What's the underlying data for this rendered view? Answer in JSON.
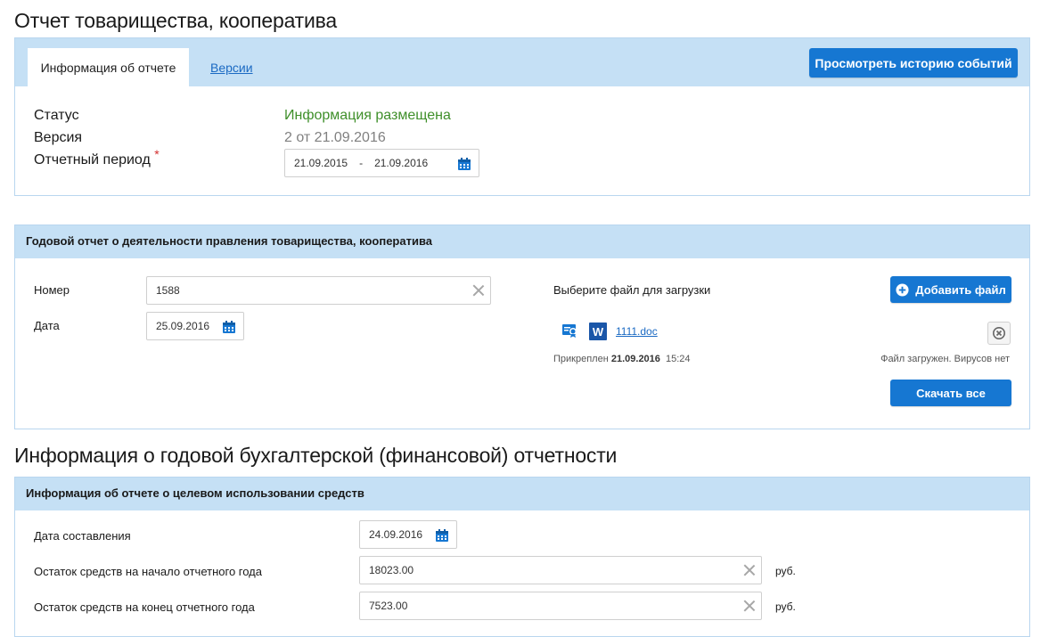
{
  "page_title": "Отчет товарищества, кооператива",
  "tabs": [
    {
      "label": "Информация об отчете"
    },
    {
      "label": "Версии"
    }
  ],
  "history_button": "Просмотреть историю событий",
  "info": {
    "status_label": "Статус",
    "status_value": "Информация размещена",
    "version_label": "Версия",
    "version_value": "2 от 21.09.2016",
    "period_label": "Отчетный период",
    "required_mark": "*",
    "period_from": "21.09.2015",
    "period_sep": "-",
    "period_to": "21.09.2016"
  },
  "annual_report": {
    "title": "Годовой отчет о деятельности правления товарищества, кооператива",
    "number_label": "Номер",
    "number_value": "1588",
    "date_label": "Дата",
    "date_value": "25.09.2016",
    "file_select_label": "Выберите файл для загрузки",
    "add_file_button": "Добавить файл",
    "file_name": "1111.doc",
    "file_type_badge": "W",
    "attached_prefix": "Прикреплен",
    "attached_date": "21.09.2016",
    "attached_time": "15:24",
    "file_status": "Файл загружен. Вирусов нет",
    "download_all_button": "Скачать все"
  },
  "accounting_title": "Информация о годовой бухгалтерской (финансовой) отчетности",
  "usage_report": {
    "title": "Информация об отчете о целевом использовании средств",
    "compile_date_label": "Дата составления",
    "compile_date_value": "24.09.2016",
    "start_balance_label": "Остаток средств на начало отчетного года",
    "start_balance_value": "18023.00",
    "end_balance_label": "Остаток средств на конец отчетного года",
    "end_balance_value": "7523.00",
    "currency": "руб."
  },
  "colors": {
    "accent": "#1677d2",
    "panel_header": "#c5e0f5",
    "status_green": "#3f8f2a",
    "link": "#1b6ac3"
  },
  "icons": [
    "calendar-icon",
    "clear-icon",
    "plus-circle-icon",
    "signature-icon",
    "word-doc-icon",
    "remove-file-icon"
  ]
}
